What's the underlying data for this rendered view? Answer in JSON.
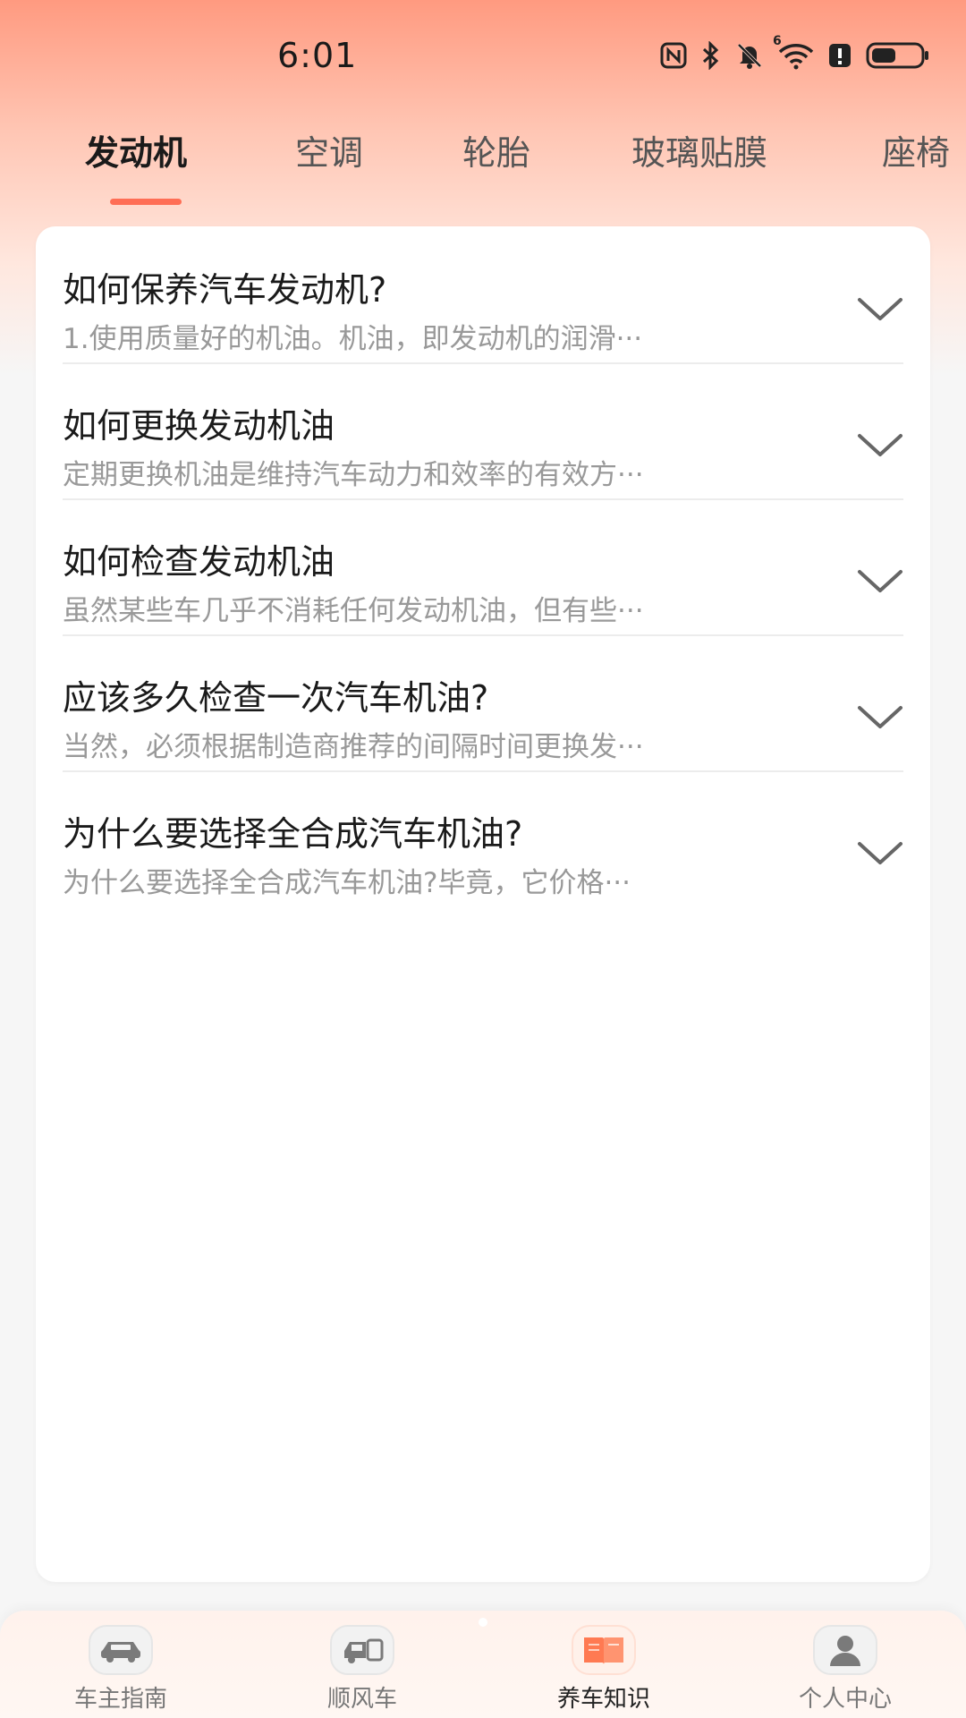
{
  "status_bar": {
    "time": "6:01",
    "icons": [
      "nfc-icon",
      "bluetooth-icon",
      "mute-bell-icon",
      "wifi-6-icon",
      "battery-alert-icon",
      "battery-icon"
    ],
    "wifi_badge": "6"
  },
  "tabs": [
    {
      "label": "发动机",
      "active": true
    },
    {
      "label": "空调",
      "active": false
    },
    {
      "label": "轮胎",
      "active": false
    },
    {
      "label": "玻璃贴膜",
      "active": false
    },
    {
      "label": "座椅",
      "active": false
    }
  ],
  "faq": [
    {
      "title": "如何保养汽车发动机?",
      "preview": "1.使用质量好的机油。机油，即发动机的润滑···"
    },
    {
      "title": "如何更换发动机油",
      "preview": "定期更换机油是维持汽车动力和效率的有效方···"
    },
    {
      "title": "如何检查发动机油",
      "preview": "虽然某些车几乎不消耗任何发动机油，但有些···"
    },
    {
      "title": "应该多久检查一次汽车机油?",
      "preview": "当然，必须根据制造商推荐的间隔时间更换发···"
    },
    {
      "title": "为什么要选择全合成汽车机油?",
      "preview": "为什么要选择全合成汽车机油?毕竟，它价格···"
    }
  ],
  "bottom_nav": [
    {
      "label": "车主指南",
      "icon": "car-icon",
      "active": false
    },
    {
      "label": "顺风车",
      "icon": "rideshare-icon",
      "active": false
    },
    {
      "label": "养车知识",
      "icon": "book-icon",
      "active": true
    },
    {
      "label": "个人中心",
      "icon": "user-icon",
      "active": false
    }
  ],
  "colors": {
    "accent": "#ff6e55",
    "header_gradient_top": "#ff9a80",
    "background": "#f6f6f6",
    "card": "#ffffff",
    "book_icon": "#ff7a52"
  }
}
